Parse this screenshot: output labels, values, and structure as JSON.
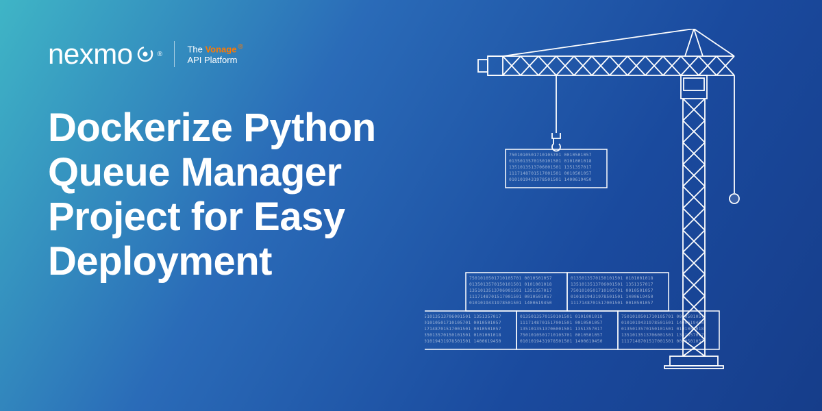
{
  "logo": {
    "brand": "nexmo",
    "reg_symbol": "®"
  },
  "tagline": {
    "line1_prefix": "The ",
    "line1_vonage": "Vonage",
    "line1_reg": "®",
    "line2": "API Platform"
  },
  "headline": {
    "line1": "Dockerize Python",
    "line2": "Queue Manager",
    "line3": "Project for Easy",
    "line4": "Deployment"
  },
  "box_numbers": {
    "r1": "7501010501710105701 0010501057",
    "r2": "0135013570150101501 0101001018",
    "r3": "1351013513706001501 1351357017",
    "r4": "1117148701517001501 0010501057",
    "r5": "0101019431978501501 1400619450"
  }
}
